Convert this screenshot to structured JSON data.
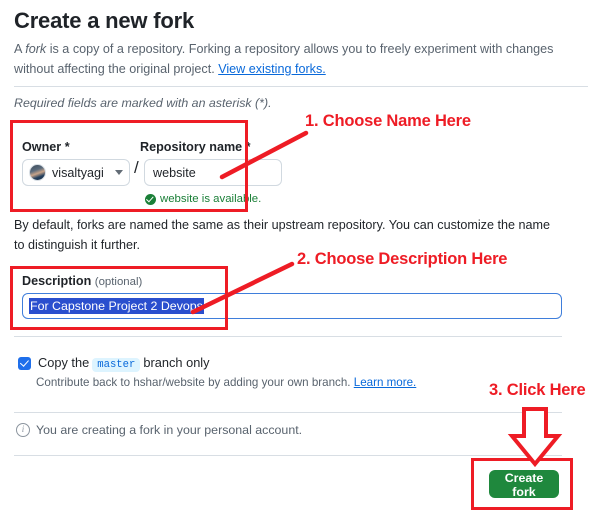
{
  "header": {
    "title": "Create a new fork",
    "subtitle_part1": "A ",
    "subtitle_italic": "fork",
    "subtitle_part2": " is a copy of a repository. Forking a repository allows you to freely experiment with changes without affecting the original project. ",
    "subtitle_link": "View existing forks.",
    "required_note": "Required fields are marked with an asterisk (*)."
  },
  "owner": {
    "label": "Owner *",
    "name": "visaltyagi",
    "avatar_icon": "user-avatar",
    "caret_icon": "chevron-down-icon",
    "separator": "/"
  },
  "repository": {
    "label": "Repository name *",
    "value": "website",
    "placeholder": "website",
    "availability": "website is available.",
    "availability_icon": "check-circle-icon",
    "availability_color": "#1a7f37"
  },
  "body_text": "By default, forks are named the same as their upstream repository. You can customize the name to distinguish it further.",
  "description": {
    "label": "Description",
    "optional": "(optional)",
    "value": "For Capstone Project 2 Devops",
    "selected": true,
    "selection_color": "#2a4fce",
    "focus_border_color": "#3f7edb"
  },
  "copy_branch": {
    "checked": true,
    "text_before": "Copy the",
    "branch_name": "master",
    "text_after": "branch only",
    "sub_text": "Contribute back to hshar/website by adding your own branch.",
    "sub_link": "Learn more.",
    "checkbox_color": "#1f6feb"
  },
  "note": {
    "icon": "info-icon",
    "text": "You are creating a fork in your personal account."
  },
  "submit": {
    "label": "Create fork",
    "color": "#1f883d"
  },
  "annotations": {
    "color": "#ee1c25",
    "step1": "1. Choose Name Here",
    "step2": "2. Choose Description Here",
    "step3": "3. Click Here",
    "arrow_down_icon": "arrow-down-icon"
  }
}
